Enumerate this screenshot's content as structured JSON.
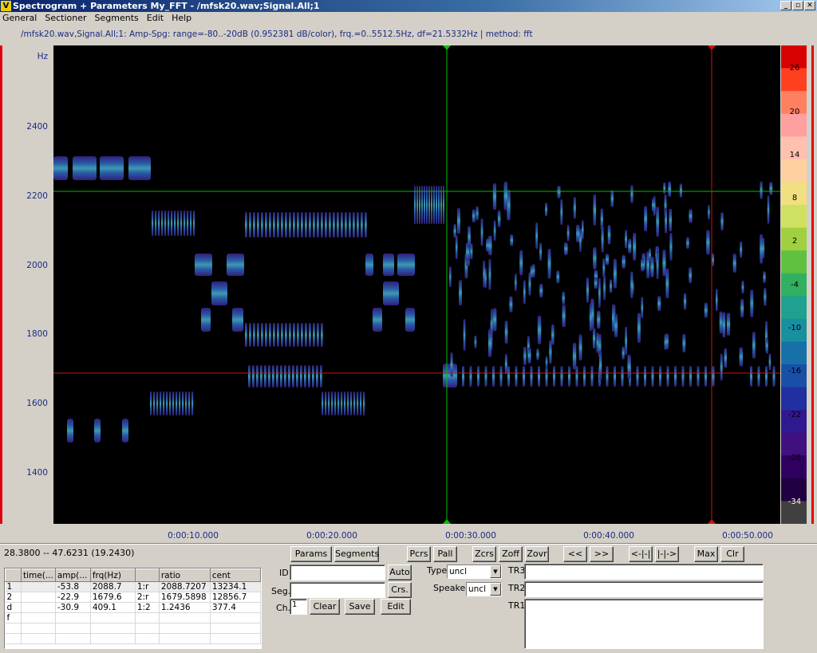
{
  "window": {
    "title": "Spectrogram + Parameters My_FFT - /mfsk20.wav;Signal.All;1",
    "app_icon": "V",
    "buttons": [
      "_",
      "▫",
      "✕"
    ]
  },
  "menu": [
    "General",
    "Sectioner",
    "Segments",
    "Edit",
    "Help"
  ],
  "info_line": "/mfsk20.wav,Signal.All;1: Amp-Spg: range=-80..-20dB (0.952381 dB/color), frq.=0..5512.5Hz, df=21.5332Hz | method: fft",
  "y_axis": {
    "unit": "Hz",
    "ticks": [
      "2400",
      "2200",
      "2000",
      "1800",
      "1600",
      "1400"
    ]
  },
  "x_axis": {
    "ticks": [
      "0:00:10.000",
      "0:00:20.000",
      "0:00:30.000",
      "0:00:40.000",
      "0:00:50.000"
    ]
  },
  "colorbar": {
    "ticks": [
      "26",
      "20",
      "14",
      "8",
      "2",
      "-4",
      "-10",
      "-16",
      "-22",
      "-28",
      "-34"
    ]
  },
  "cursors": {
    "time_green_s": 28.38,
    "time_red_s": 47.6231,
    "freq_green_hz": 2088.7,
    "freq_red_hz": 1679.6
  },
  "status": "28.3800 -- 47.6231 (19.2430)",
  "table": {
    "headers": [
      "",
      "time(...",
      "amp(...",
      "frq(Hz)",
      "",
      "ratio",
      "cent"
    ],
    "rows": [
      [
        "1",
        "",
        "-53.8",
        "2088.7",
        "1:r",
        "2088.7207",
        "13234.1"
      ],
      [
        "2",
        "",
        "-22.9",
        "1679.6",
        "2:r",
        "1679.5898",
        "12856.7"
      ],
      [
        "d",
        "",
        "-30.9",
        "409.1",
        "1:2",
        "1.2436",
        "377.4"
      ],
      [
        "f",
        "",
        "",
        "",
        "",
        "",
        ""
      ],
      [
        "",
        "",
        "",
        "",
        "",
        "",
        ""
      ],
      [
        "",
        "",
        "",
        "",
        "",
        "",
        ""
      ]
    ]
  },
  "controls": {
    "params": "Params",
    "segments": "Segments",
    "pcrs": "Pcrs",
    "pall": "Pall",
    "zcrs": "Zcrs",
    "zoff": "Zoff",
    "zovr": "Zovr",
    "prev": "<<",
    "next": ">>",
    "left": "<-|-|",
    "right": "|-|->",
    "max": "Max",
    "clr": "Clr",
    "auto": "Auto",
    "crs": "Crs.",
    "clear": "Clear",
    "save": "Save",
    "edit": "Edit",
    "id_label": "ID",
    "seg_label": "Seg.",
    "ch_label": "Ch.",
    "ch_value": "1",
    "type_label": "Type",
    "type_value": "uncl",
    "speaker_label": "Speaker",
    "speaker_value": "uncl",
    "tr3": "TR3",
    "tr2": "TR2",
    "tr1": "TR1"
  }
}
